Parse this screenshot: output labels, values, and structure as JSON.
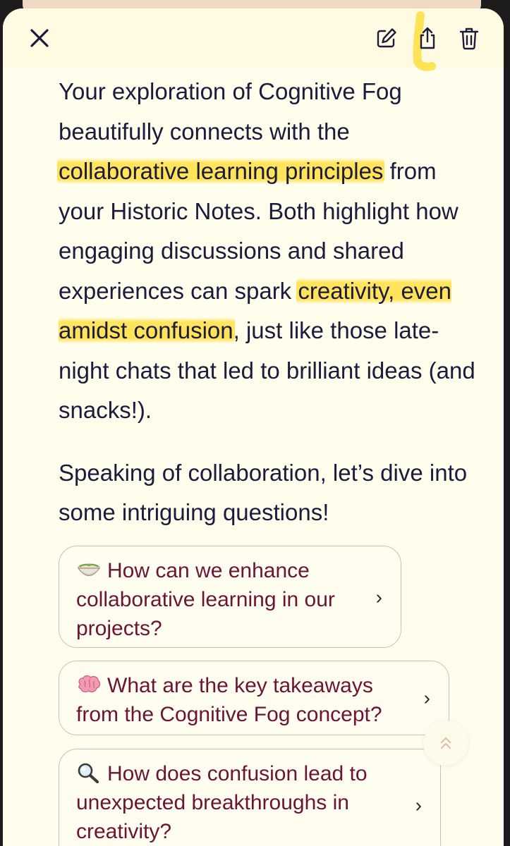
{
  "toolbar": {
    "close_icon": "close-icon",
    "edit_icon": "edit-icon",
    "share_icon": "share-icon",
    "delete_icon": "trash-icon"
  },
  "message": {
    "p1_a": "Your exploration of Cognitive Fog beautifully connects with the ",
    "p1_hl1": "collaborative learning principles",
    "p1_b": " from your Historic Notes. Both highlight how engaging discussions and shared experiences can spark ",
    "p1_hl2": "creativity, even amidst confusion",
    "p1_c": ", just like those late-night chats that led to brilliant ideas (and snacks!).",
    "p2": "Speaking of collaboration, let’s dive into some intriguing questions!"
  },
  "suggestions": [
    {
      "icon": "ramen-bowl-icon",
      "label": "How can we enhance collaborative learning in our projects?"
    },
    {
      "icon": "brain-icon",
      "label": "What are the key takeaways from the Cognitive Fog concept?"
    },
    {
      "icon": "magnifying-glass-icon",
      "label": "How does confusion lead to unexpected breakthroughs in creativity?"
    }
  ],
  "scroll_top_icon": "double-chevron-up-icon",
  "colors": {
    "background": "#fffdec",
    "text": "#1c1a3d",
    "suggestion_text": "#6b1436",
    "highlight": "#ffe046"
  }
}
